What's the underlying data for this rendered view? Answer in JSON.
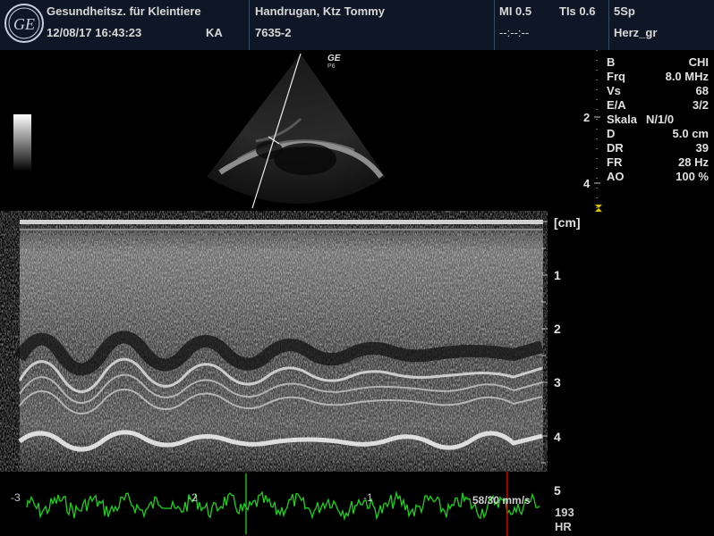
{
  "header": {
    "clinic": "Gesundheitsz. für Kleintiere",
    "datetime": "12/08/17 16:43:23",
    "operator": "KA",
    "patient": "Handrugan, Ktz Tommy",
    "patient_id": "7635-2",
    "mi": "MI 0.5",
    "tis": "TIs 0.6",
    "tis_sub": "--:--:--",
    "probe": "5Sp",
    "preset": "Herz_gr"
  },
  "params": [
    {
      "key": "B",
      "value": "CHI"
    },
    {
      "key": "Frq",
      "value": "8.0 MHz"
    },
    {
      "key": "Vs",
      "value": "68"
    },
    {
      "key": "E/A",
      "value": "3/2"
    },
    {
      "key": "Skala",
      "value": "N/1/0"
    },
    {
      "key": "D",
      "value": "5.0 cm"
    },
    {
      "key": "DR",
      "value": "39"
    },
    {
      "key": "FR",
      "value": "28 Hz"
    },
    {
      "key": "AO",
      "value": "100 %"
    }
  ],
  "sector": {
    "logo_text": "GE",
    "probe_mark": "P6",
    "depth_marks": [
      "2",
      "4"
    ]
  },
  "mmode": {
    "unit_label": "[cm]",
    "depth_ticks": [
      "1",
      "2",
      "3",
      "4",
      "5"
    ]
  },
  "ecg": {
    "time_marks": [
      "-3",
      "-2",
      "-1"
    ],
    "sweep_speed": "58/30 mm/s",
    "hr_value": "193",
    "hr_label": "HR"
  },
  "colors": {
    "header_bg": "#0f1626",
    "ecg_trace": "#1fd11f",
    "marker": "#e0c000",
    "cursor": "#d00000"
  },
  "icons": [
    "ge-logo-icon",
    "depth-marker-icon"
  ]
}
